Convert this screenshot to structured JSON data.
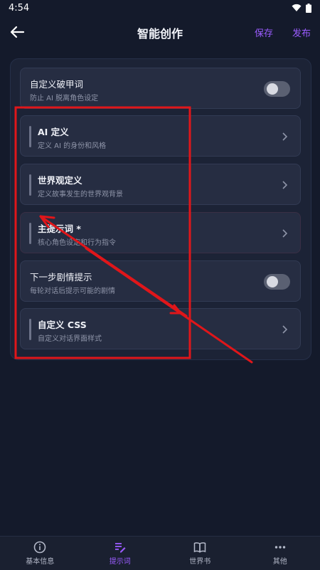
{
  "status": {
    "time": "4:54"
  },
  "header": {
    "title": "智能创作",
    "save_label": "保存",
    "publish_label": "发布"
  },
  "cards": [
    {
      "title": "自定义破甲词",
      "subtitle": "防止 AI 脱离角色设定",
      "control": "toggle",
      "toggle_on": false
    },
    {
      "title": "AI 定义",
      "subtitle": "定义 AI 的身份和风格",
      "control": "chevron"
    },
    {
      "title": "世界观定义",
      "subtitle": "定义故事发生的世界观背景",
      "control": "chevron"
    },
    {
      "title": "主提示词 *",
      "subtitle": "核心角色设定和行为指令",
      "control": "chevron"
    },
    {
      "title": "下一步剧情提示",
      "subtitle": "每轮对话后提示可能的剧情",
      "control": "toggle",
      "toggle_on": false
    },
    {
      "title": "自定义 CSS",
      "subtitle": "自定义对话界面样式",
      "control": "chevron"
    }
  ],
  "nav": [
    {
      "label": "基本信息",
      "icon": "info-icon",
      "active": false
    },
    {
      "label": "提示词",
      "icon": "edit-icon",
      "active": true
    },
    {
      "label": "世界书",
      "icon": "book-icon",
      "active": false
    },
    {
      "label": "其他",
      "icon": "more-icon",
      "active": false
    }
  ],
  "colors": {
    "accent": "#9b5cff",
    "background": "#141a2b",
    "annotation": "#e0161a"
  }
}
